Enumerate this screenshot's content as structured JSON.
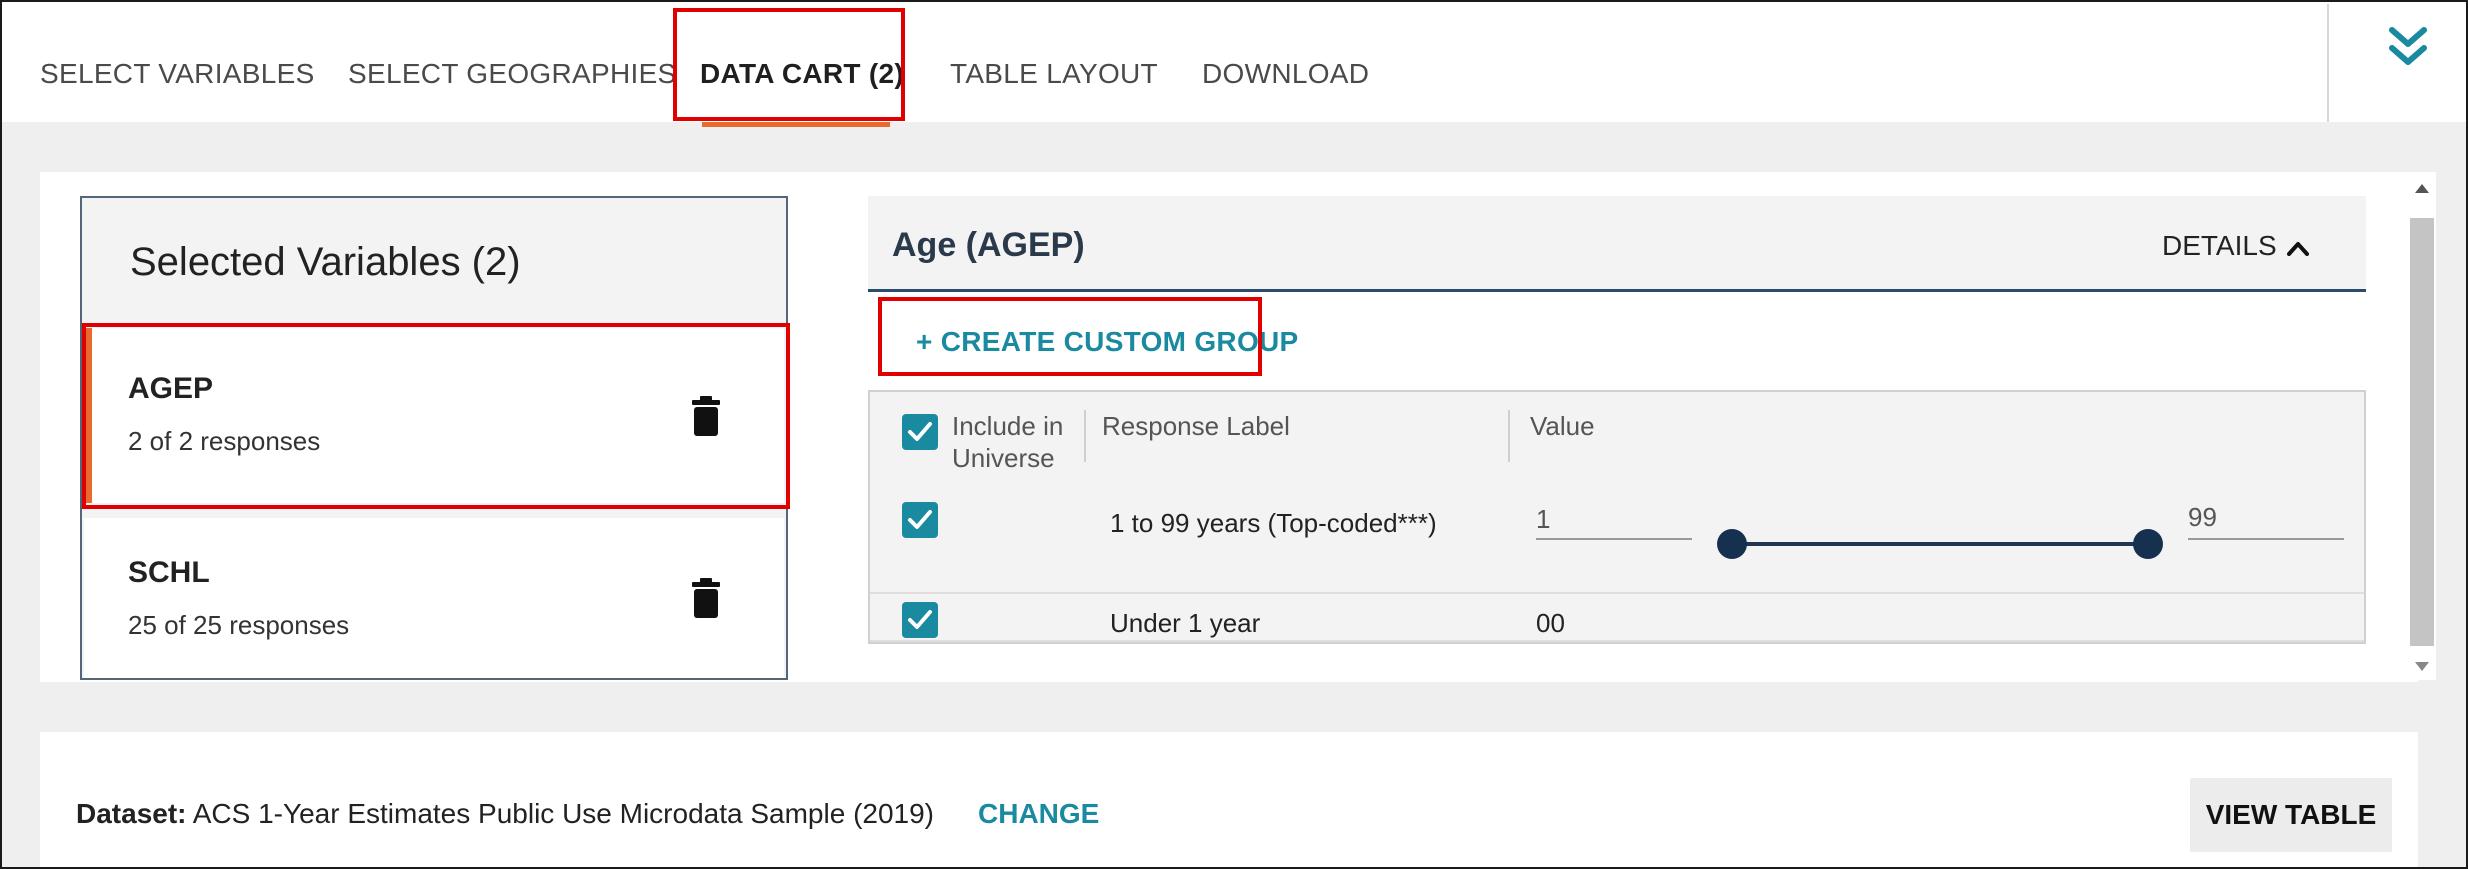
{
  "nav": {
    "tabs": [
      {
        "label": "SELECT VARIABLES"
      },
      {
        "label": "SELECT GEOGRAPHIES"
      },
      {
        "label": "DATA CART (2)"
      },
      {
        "label": "TABLE LAYOUT"
      },
      {
        "label": "DOWNLOAD"
      }
    ],
    "active_tab": "DATA CART (2)",
    "collapse_icon": "double-chevron-down-icon"
  },
  "selected_variables": {
    "title": "Selected Variables (2)",
    "items": [
      {
        "name": "AGEP",
        "count": "2 of 2 responses",
        "selected": true
      },
      {
        "name": "SCHL",
        "count": "25 of 25 responses",
        "selected": false
      }
    ],
    "delete_icon": "trash-icon"
  },
  "variable_panel": {
    "title": "Age (AGEP)",
    "details_label": "DETAILS",
    "create_group_label": "+ CREATE CUSTOM GROUP",
    "columns": {
      "include": "Include in Universe",
      "include_line1": "Include in",
      "include_line2": "Universe",
      "response": "Response Label",
      "value": "Value"
    },
    "rows": [
      {
        "checked": true,
        "label": "1 to 99 years (Top-coded***)",
        "min": "1",
        "max": "99",
        "slider_min_fraction": 0,
        "slider_max_fraction": 1
      },
      {
        "checked": true,
        "label": "Under 1 year",
        "value": "00"
      }
    ]
  },
  "footer": {
    "dataset_label": "Dataset:",
    "dataset_value": "ACS 1-Year Estimates Public Use Microdata Sample (2019)",
    "change_label": "CHANGE",
    "view_table_label": "VIEW TABLE"
  },
  "colors": {
    "accent_orange": "#e86a2e",
    "teal": "#1a8aa0",
    "highlight_red": "#e00000",
    "navy": "#1f3550"
  }
}
